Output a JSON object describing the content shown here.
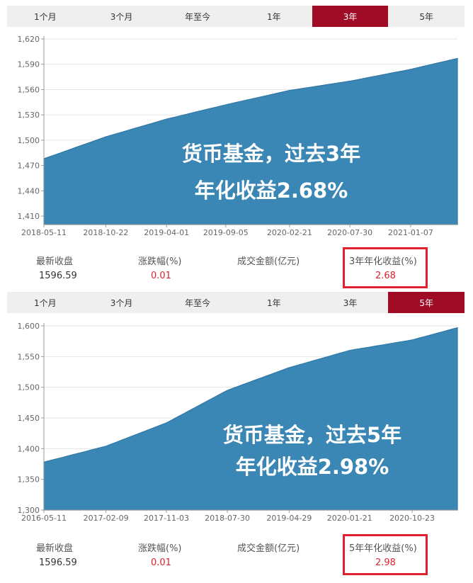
{
  "tabs": [
    "1个月",
    "3个月",
    "年至今",
    "1年",
    "3年",
    "5年"
  ],
  "colors": {
    "accent": "#a00b25",
    "area": "#3a87b5",
    "highlight": "#e0212f",
    "tabbar": "#efefef"
  },
  "panels": [
    {
      "active_tab": "3年",
      "annotation": [
        "货币基金，过去3年",
        "年化收益2.68%"
      ],
      "stats": {
        "labels": [
          "最新收盘",
          "涨跌幅(%)",
          "成交金额(亿元)",
          "3年年化收益(%)"
        ],
        "values": [
          "1596.59",
          "0.01",
          "",
          "2.68"
        ]
      }
    },
    {
      "active_tab": "5年",
      "annotation": [
        "货币基金，过去5年",
        "年化收益2.98%"
      ],
      "stats": {
        "labels": [
          "最新收盘",
          "涨跌幅(%)",
          "成交金额(亿元)",
          "5年年化收益(%)"
        ],
        "values": [
          "1596.59",
          "0.01",
          "",
          "2.98"
        ]
      }
    }
  ],
  "chart_data": [
    {
      "type": "area",
      "ylim": [
        1400,
        1620
      ],
      "yticks": [
        1410,
        1440,
        1470,
        1500,
        1530,
        1560,
        1590,
        1620
      ],
      "ytick_labels": [
        "1,410",
        "1,440",
        "1,470",
        "1,500",
        "1,530",
        "1,560",
        "1,590",
        "1,620"
      ],
      "xtick_labels": [
        "2018-05-11",
        "2018-10-22",
        "2019-04-01",
        "2019-09-05",
        "2020-02-21",
        "2020-07-30",
        "2021-01-07"
      ],
      "x": [
        "2018-05-11",
        "2018-10-22",
        "2019-04-01",
        "2019-09-05",
        "2020-02-21",
        "2020-07-30",
        "2021-01-07",
        "2021-05-11"
      ],
      "y": [
        1478,
        1504,
        1525,
        1542,
        1559,
        1570,
        1584,
        1597
      ],
      "grid": true
    },
    {
      "type": "area",
      "ylim": [
        1300,
        1600
      ],
      "yticks": [
        1300,
        1350,
        1400,
        1450,
        1500,
        1550,
        1600
      ],
      "ytick_labels": [
        "1,300",
        "1,350",
        "1,400",
        "1,450",
        "1,500",
        "1,550",
        "1,600"
      ],
      "xtick_labels": [
        "2016-05-11",
        "2017-02-09",
        "2017-11-03",
        "2018-07-30",
        "2019-04-29",
        "2020-01-21",
        "2020-10-23"
      ],
      "x": [
        "2016-05-11",
        "2017-02-09",
        "2017-11-03",
        "2018-07-30",
        "2019-04-29",
        "2020-01-21",
        "2020-10-23",
        "2021-05-11"
      ],
      "y": [
        1378,
        1404,
        1442,
        1495,
        1532,
        1560,
        1577,
        1597
      ],
      "grid": true
    }
  ]
}
